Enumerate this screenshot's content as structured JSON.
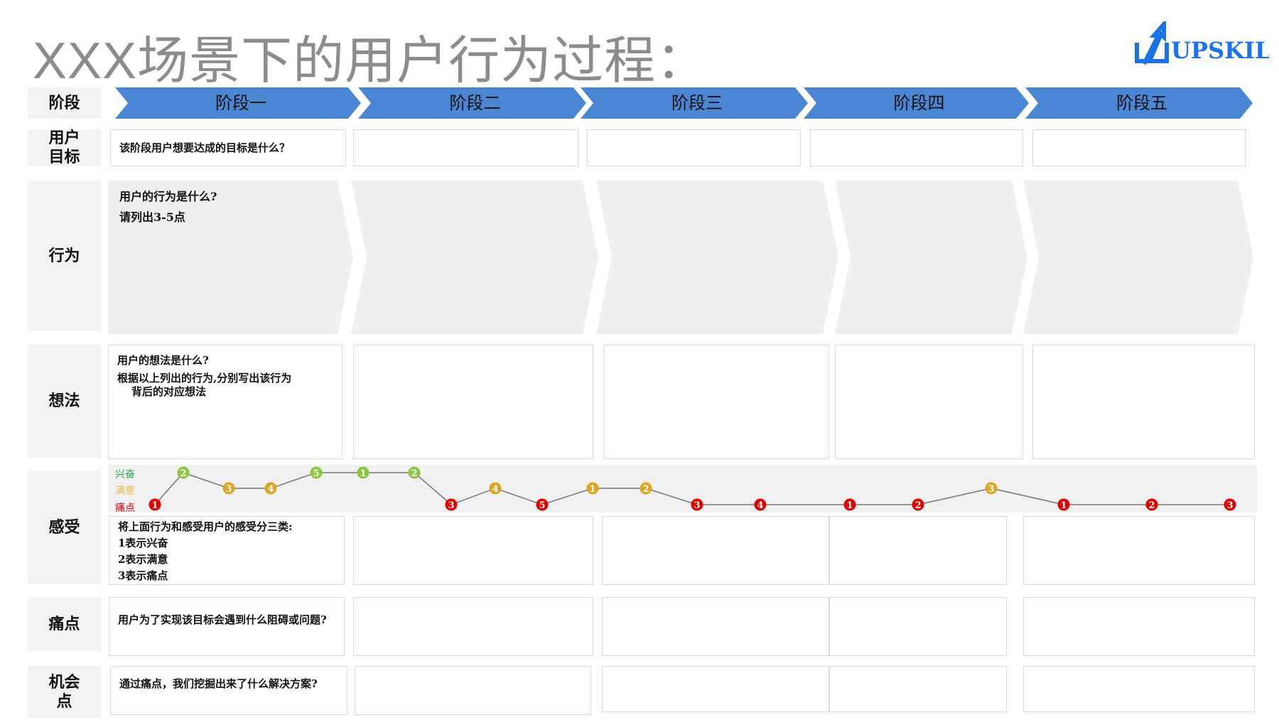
{
  "title": "XXX场景下的用户行为过程：",
  "logo": {
    "text": "UPSKILL",
    "brand_color": "#1a73e8"
  },
  "row_labels": {
    "stage": "阶段",
    "goal_line1": "用户",
    "goal_line2": "目标",
    "behavior": "行为",
    "thoughts": "想法",
    "feelings": "感受",
    "pain_points": "痛点",
    "opportunity_line1": "机会",
    "opportunity_line2": "点"
  },
  "stages": [
    "阶段一",
    "阶段二",
    "阶段三",
    "阶段四",
    "阶段五"
  ],
  "goal": {
    "prompt": "该阶段用户想要达成的目标是什么？"
  },
  "behavior": {
    "line1": "用户的行为是什么?",
    "line2": "请列出3-5点"
  },
  "thoughts": {
    "line1": "用户的想法是什么?",
    "line2": "根据以上列出的行为,分别写出该行为",
    "line3": "背后的对应想法"
  },
  "feelings": {
    "legend": {
      "excited": "兴奋",
      "satisfied": "满意",
      "pain": "痛点"
    },
    "colors": {
      "excited": "#8cc63f",
      "satisfied": "#daa520",
      "pain": "#e00000",
      "excited_label": "#2fa84f",
      "satisfied_label": "#e8b84a",
      "pain_label": "#e00000"
    },
    "points": [
      {
        "label": "1",
        "level": "pain"
      },
      {
        "label": "2",
        "level": "excited"
      },
      {
        "label": "3",
        "level": "satisfied"
      },
      {
        "label": "4",
        "level": "satisfied"
      },
      {
        "label": "5",
        "level": "excited"
      },
      {
        "label": "1",
        "level": "excited"
      },
      {
        "label": "2",
        "level": "excited"
      },
      {
        "label": "3",
        "level": "pain"
      },
      {
        "label": "4",
        "level": "satisfied"
      },
      {
        "label": "5",
        "level": "pain"
      },
      {
        "label": "1",
        "level": "satisfied"
      },
      {
        "label": "2",
        "level": "satisfied"
      },
      {
        "label": "3",
        "level": "pain"
      },
      {
        "label": "4",
        "level": "pain"
      },
      {
        "label": "1",
        "level": "pain"
      },
      {
        "label": "2",
        "level": "pain"
      },
      {
        "label": "3",
        "level": "satisfied"
      },
      {
        "label": "1",
        "level": "pain"
      },
      {
        "label": "2",
        "level": "pain"
      },
      {
        "label": "3",
        "level": "pain"
      }
    ],
    "line1": "将上面行为和感受用户的感受分三类:",
    "line2": "1表示兴奋",
    "line3": "2表示满意",
    "line4": "3表示痛点"
  },
  "pain_points": {
    "prompt": "用户为了实现该目标会遇到什么阻碍或问题?"
  },
  "opportunity": {
    "prompt": "通过痛点，我们挖掘出来了什么解决方案?"
  },
  "stage_color": "#4a86d4"
}
